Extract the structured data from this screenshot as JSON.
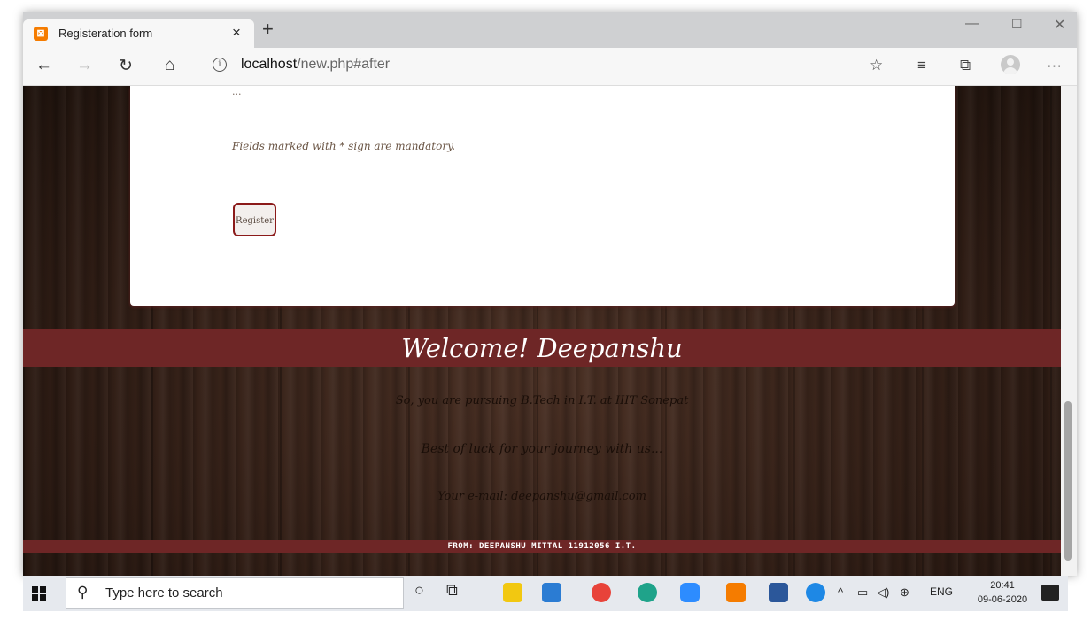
{
  "browser": {
    "tab_title": "Registeration form",
    "tab_icon": "xampp-icon",
    "new_tab_glyph": "+",
    "close_tab_glyph": "×",
    "url_host": "localhost",
    "url_path": "/new.php#after",
    "buttons": [
      "back",
      "forward",
      "refresh",
      "home",
      "favorite",
      "favorites-list",
      "collections",
      "profile",
      "more"
    ]
  },
  "page": {
    "cut_off_text": "...",
    "mandatory_note": "Fields marked with * sign are mandatory.",
    "register_label": "Register",
    "welcome": "Welcome! Deepanshu",
    "line1": "So, you are pursuing B.Tech in I.T. at IIIT Sonepat",
    "line2": "Best of luck for your journey with us...",
    "line3": "Your e-mail: deepanshu@gmail.com",
    "footer": "FROM:  DEEPANSHU MITTAL   11912056   I.T."
  },
  "colors": {
    "band": "#6e2626",
    "register_border": "#8b1a1a",
    "wood_dark": "#2e1c14"
  },
  "taskbar": {
    "search_placeholder": "Type here to search",
    "time": "20:41",
    "date": "09-06-2020",
    "language": "ENG",
    "apps": [
      "cortana-icon",
      "task-view-icon",
      "file-explorer-icon",
      "vscode-icon",
      "chrome-icon",
      "edge-icon",
      "zoom-icon",
      "xampp-icon",
      "word-icon",
      "help-icon"
    ]
  }
}
